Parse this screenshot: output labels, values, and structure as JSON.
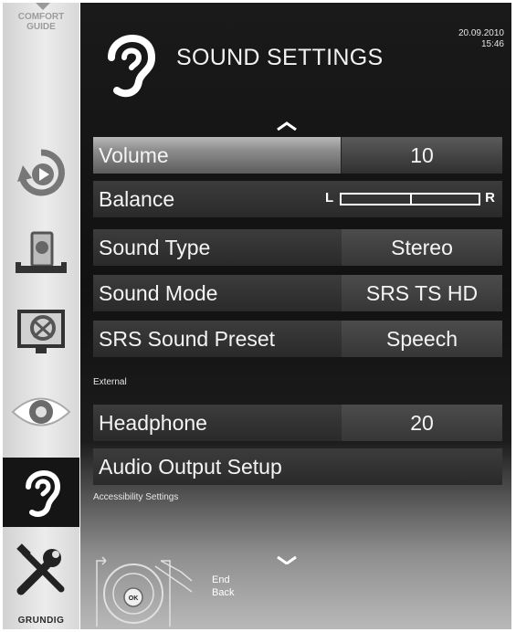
{
  "sidebar": {
    "comfort_line1": "COMFORT",
    "comfort_line2": "GUIDE",
    "icons": [
      "source-icon",
      "media-icon",
      "picture-icon",
      "eye-icon",
      "sound-icon",
      "tools-icon"
    ],
    "active": "sound-icon",
    "brand": "GRUNDIG"
  },
  "header": {
    "title": "SOUND SETTINGS",
    "date": "20.09.2010",
    "time": "15:46"
  },
  "menu": {
    "rows": [
      {
        "label": "Volume",
        "value": "10",
        "selected": true
      },
      {
        "label": "Balance",
        "left": "L",
        "right": "R",
        "balance_position": 0.5
      },
      {
        "label": "Sound Type",
        "value": "Stereo"
      },
      {
        "label": "Sound Mode",
        "value": "SRS TS HD"
      },
      {
        "label": "SRS Sound Preset",
        "value": "Speech"
      }
    ],
    "external_section": "External",
    "external_rows": [
      {
        "label": "Headphone",
        "value": "20"
      },
      {
        "label": "Audio Output Setup"
      }
    ],
    "accessibility_section": "Accessibility Settings"
  },
  "footer": {
    "ok_label": "OK",
    "hint_end": "End",
    "hint_back": "Back"
  },
  "colors": {
    "panel": "#111111",
    "sidebar": "#e4e4e4",
    "selected_highlight": "#a8a8a8",
    "text": "#f4f4f4"
  }
}
